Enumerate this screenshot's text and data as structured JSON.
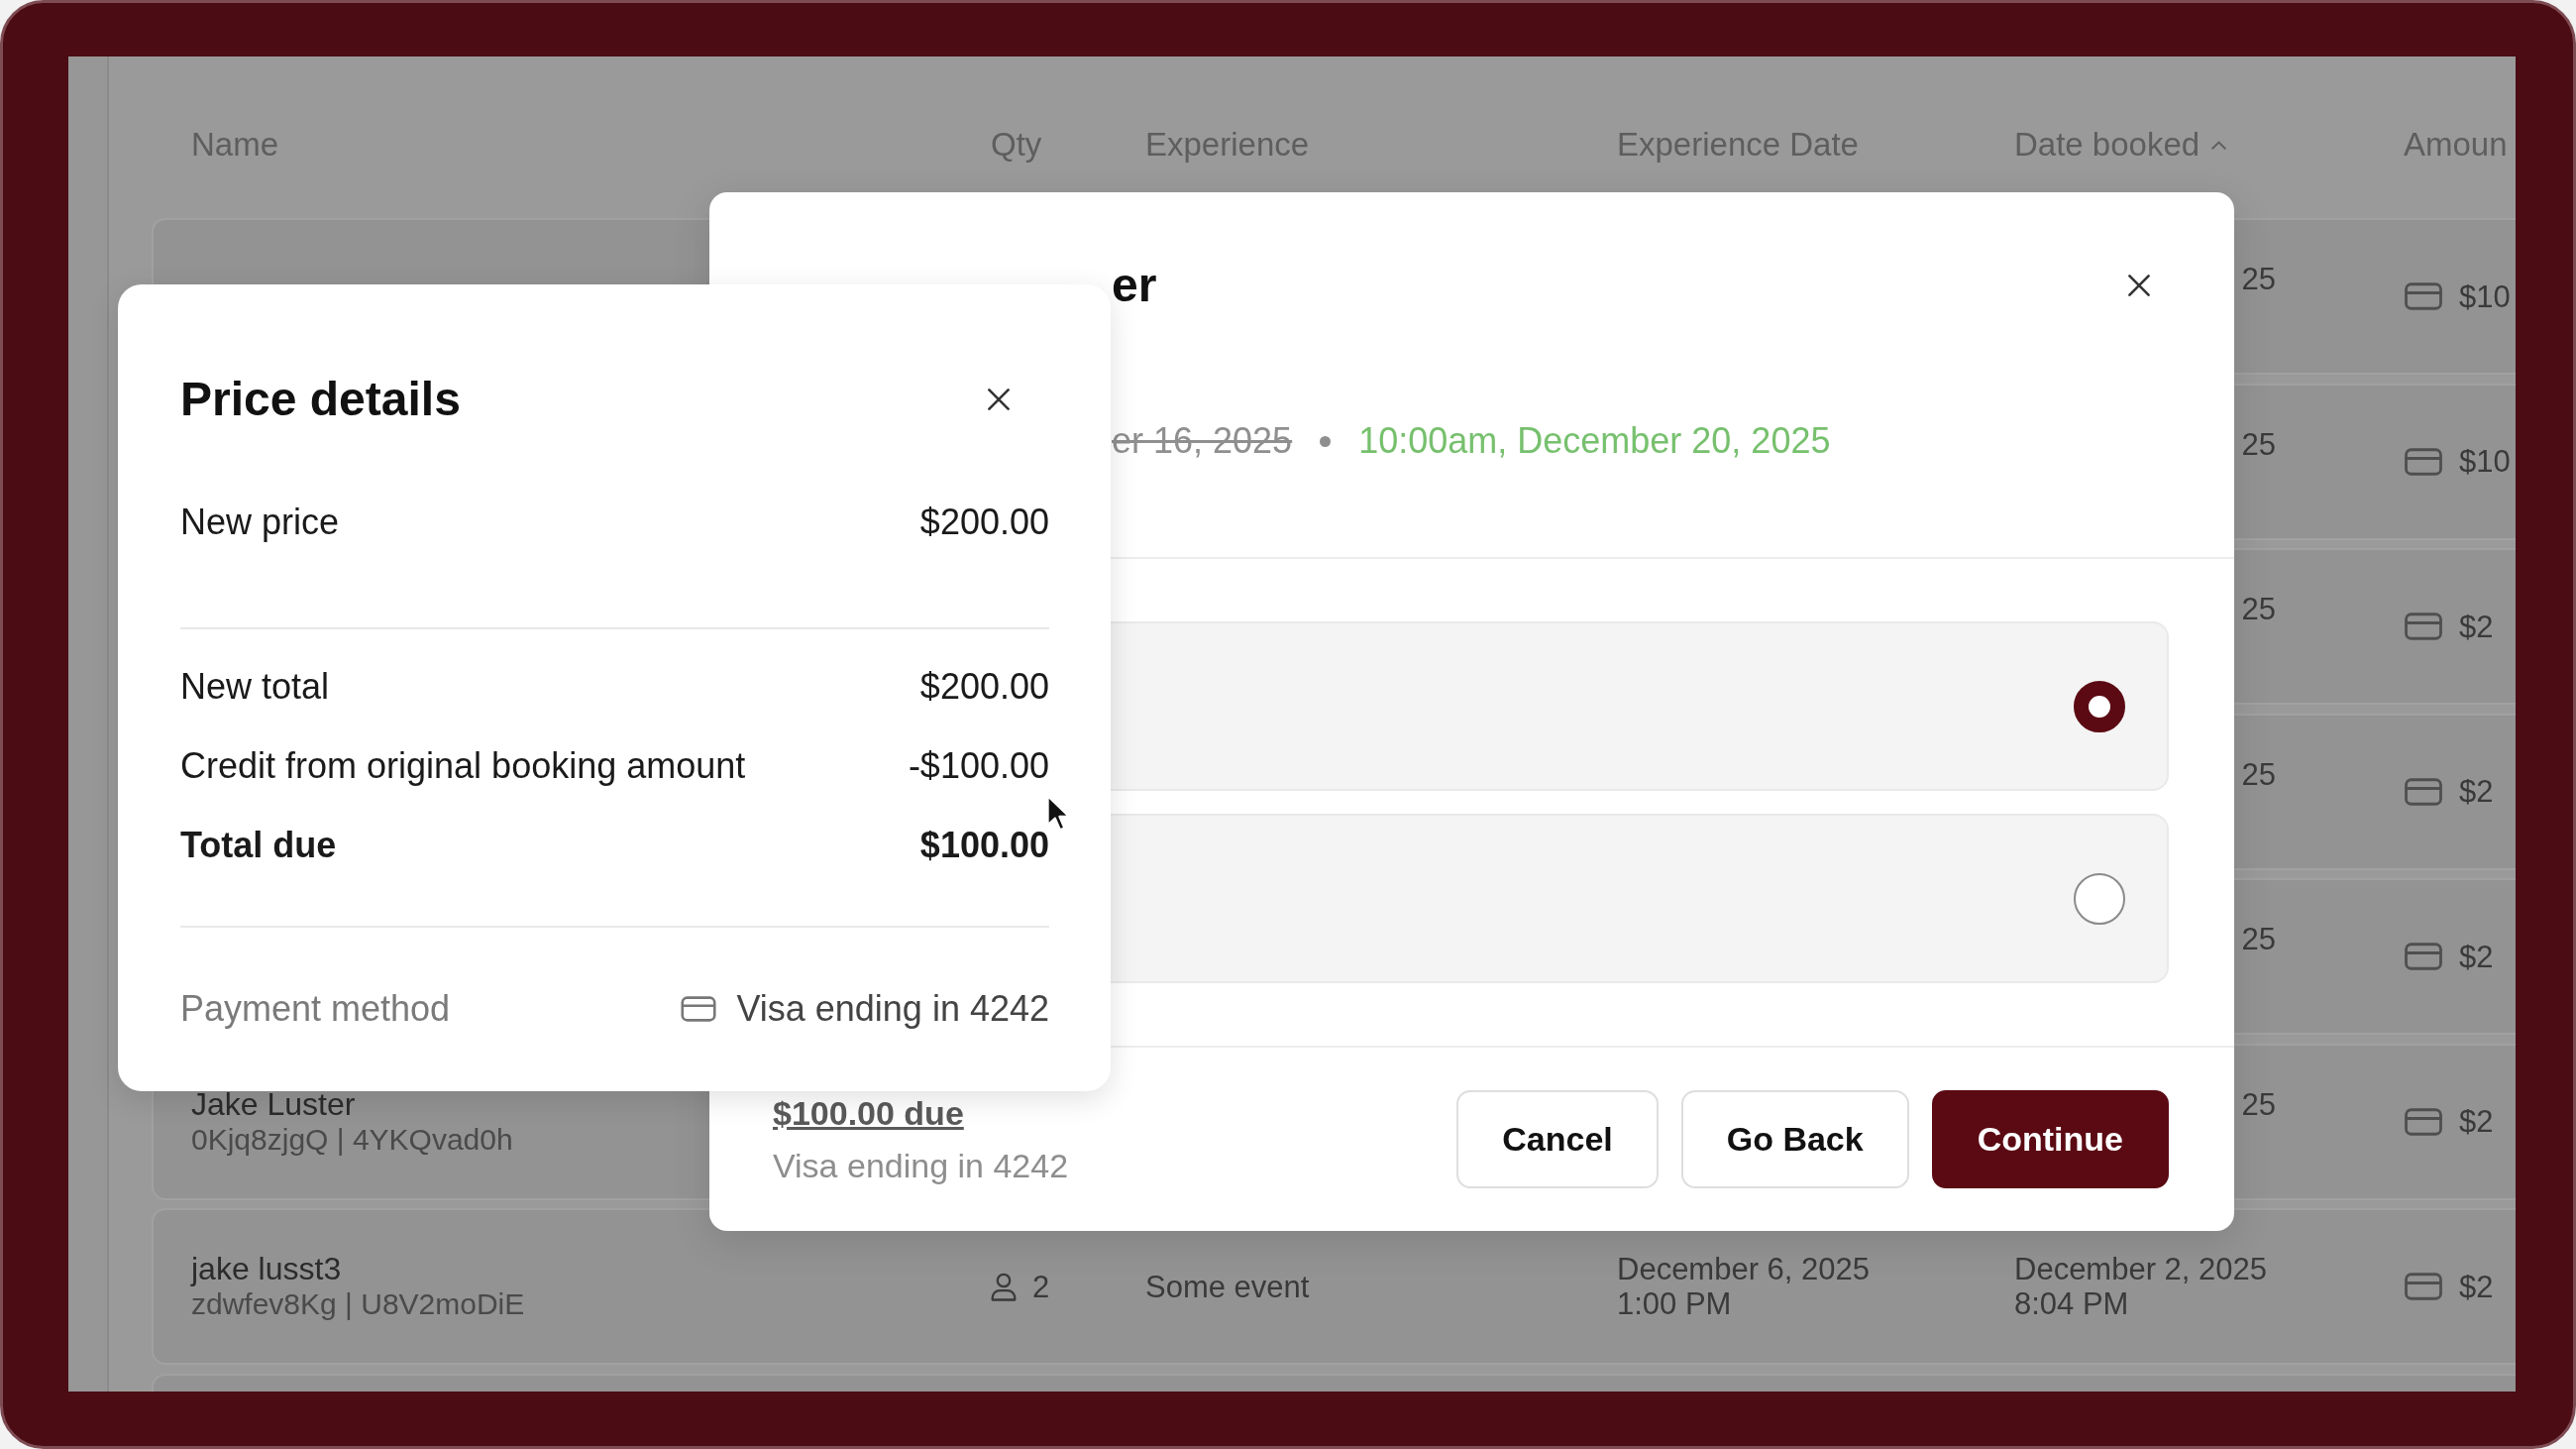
{
  "table": {
    "columns": [
      {
        "label": "Name",
        "sorted": false
      },
      {
        "label": "Qty",
        "sorted": false
      },
      {
        "label": "Experience",
        "sorted": false
      },
      {
        "label": "Experience Date",
        "sorted": false
      },
      {
        "label": "Date booked",
        "sorted": true
      },
      {
        "label": "Amoun",
        "sorted": false
      }
    ],
    "rows": [
      {
        "kind": "covered",
        "date_booked": [
          "25"
        ],
        "amount": "$10"
      },
      {
        "kind": "covered",
        "date_booked": [
          "25"
        ],
        "amount": "$10"
      },
      {
        "kind": "covered",
        "date_booked": [
          "25"
        ],
        "amount": "$2"
      },
      {
        "kind": "covered",
        "date_booked": [
          "25"
        ],
        "amount": "$2"
      },
      {
        "kind": "covered",
        "date_booked": [
          "25"
        ],
        "amount": "$2"
      },
      {
        "kind": "covered",
        "name": "Jake Luster",
        "booking_ids": "0Kjq8zjgQ | 4YKQvad0h",
        "date_booked": [
          "25"
        ],
        "amount": "$2"
      },
      {
        "kind": "full",
        "name": "jake lusst3",
        "booking_ids": "zdwfev8Kg | U8V2moDiE",
        "qty": "2",
        "experience": "Some event",
        "experience_date": [
          "December 6, 2025",
          "1:00 PM"
        ],
        "date_booked": [
          "December 2, 2025",
          "8:04 PM"
        ],
        "amount": "$2"
      },
      {
        "kind": "empty"
      }
    ]
  },
  "price_tier_dialog": {
    "title": "er",
    "old_date": "er 16, 2025",
    "new_date": "10:00am, December 20, 2025",
    "options": [
      {
        "selected": true
      },
      {
        "selected": false
      }
    ],
    "amount_due": "$100.00 due",
    "payment_method": "Visa ending in 4242",
    "buttons": [
      {
        "label": "Cancel",
        "kind": "secondary"
      },
      {
        "label": "Go Back",
        "kind": "secondary"
      },
      {
        "label": "Continue",
        "kind": "primary"
      }
    ]
  },
  "price_details": {
    "title": "Price details",
    "lines": [
      {
        "label": "New price",
        "value": "$200.00"
      }
    ],
    "totals": [
      {
        "label": "New total",
        "value": "$200.00",
        "emphasis": false
      },
      {
        "label": "Credit from original booking amount",
        "value": "-$100.00",
        "emphasis": false
      },
      {
        "label": "Total due",
        "value": "$100.00",
        "emphasis": true
      }
    ],
    "payment": {
      "label": "Payment method",
      "value": "Visa ending in 4242"
    }
  }
}
